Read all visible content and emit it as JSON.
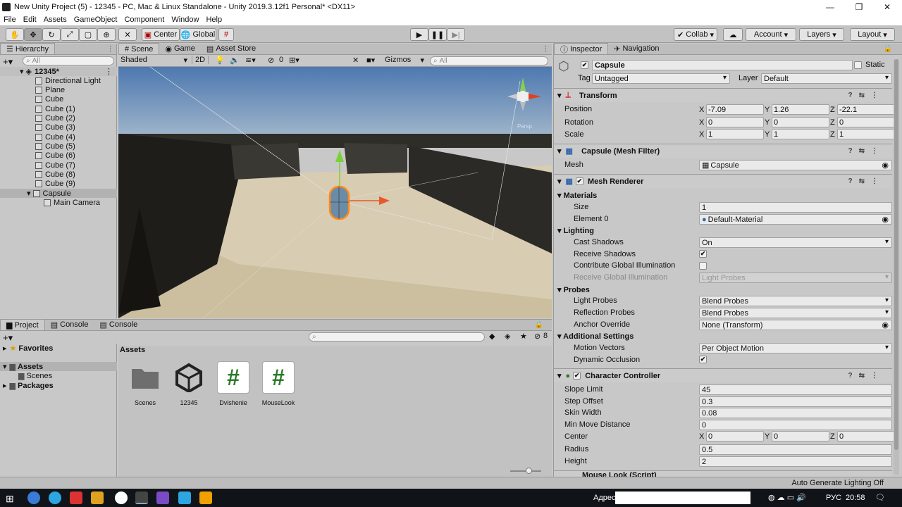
{
  "window": {
    "title": "New Unity Project (5) - 12345 - PC, Mac & Linux Standalone - Unity 2019.3.12f1 Personal* <DX11>"
  },
  "menu": [
    "File",
    "Edit",
    "Assets",
    "GameObject",
    "Component",
    "Window",
    "Help"
  ],
  "toolbar": {
    "center_label": "Center",
    "global_label": "Global",
    "collab_label": "Collab",
    "account_label": "Account",
    "layers_label": "Layers",
    "layout_label": "Layout"
  },
  "hierarchy": {
    "tab": "Hierarchy",
    "search_placeholder": "All",
    "scene_name": "12345*",
    "items": [
      "Directional Light",
      "Plane",
      "Cube",
      "Cube (1)",
      "Cube (2)",
      "Cube (3)",
      "Cube (4)",
      "Cube (5)",
      "Cube (6)",
      "Cube (7)",
      "Cube (8)",
      "Cube (9)",
      "Capsule",
      "Main Camera"
    ]
  },
  "scene": {
    "tabs": [
      "Scene",
      "Game",
      "Asset Store"
    ],
    "shading": "Shaded",
    "mode_2d": "2D",
    "hidden_count": "0",
    "gizmos": "Gizmos",
    "search_placeholder": "All",
    "persp": "Persp"
  },
  "inspector": {
    "tabs": [
      "Inspector",
      "Navigation"
    ],
    "object_name": "Capsule",
    "static_label": "Static",
    "tag_label": "Tag",
    "tag_value": "Untagged",
    "layer_label": "Layer",
    "layer_value": "Default",
    "transform": {
      "title": "Transform",
      "position_label": "Position",
      "rotation_label": "Rotation",
      "scale_label": "Scale",
      "position": [
        "-7.09",
        "1.26",
        "-22.1"
      ],
      "rotation": [
        "0",
        "0",
        "0"
      ],
      "scale": [
        "1",
        "1",
        "1"
      ]
    },
    "mesh_filter": {
      "title": "Capsule (Mesh Filter)",
      "mesh_label": "Mesh",
      "mesh_value": "Capsule"
    },
    "mesh_renderer": {
      "title": "Mesh Renderer",
      "materials": "Materials",
      "size_label": "Size",
      "size": "1",
      "element0_label": "Element 0",
      "element0": "Default-Material",
      "lighting": "Lighting",
      "cast_shadows_label": "Cast Shadows",
      "cast_shadows": "On",
      "receive_shadows_label": "Receive Shadows",
      "contribute_gi_label": "Contribute Global Illumination",
      "receive_gi_label": "Receive Global Illumination",
      "receive_gi": "Light Probes",
      "probes": "Probes",
      "light_probes_label": "Light Probes",
      "light_probes": "Blend Probes",
      "reflection_probes_label": "Reflection Probes",
      "reflection_probes": "Blend Probes",
      "anchor_label": "Anchor Override",
      "anchor": "None (Transform)",
      "additional": "Additional Settings",
      "motion_label": "Motion Vectors",
      "motion": "Per Object Motion",
      "dynamic_occlusion_label": "Dynamic Occlusion"
    },
    "character_controller": {
      "title": "Character Controller",
      "slope_label": "Slope Limit",
      "slope": "45",
      "step_label": "Step Offset",
      "step": "0.3",
      "skin_label": "Skin Width",
      "skin": "0.08",
      "min_move_label": "Min Move Distance",
      "min_move": "0",
      "center_label": "Center",
      "center": [
        "0",
        "0",
        "0"
      ],
      "radius_label": "Radius",
      "radius": "0.5",
      "height_label": "Height",
      "height": "2"
    },
    "next_component": "Mouse Look (Script)"
  },
  "project": {
    "tabs": [
      "Project",
      "Console",
      "Console"
    ],
    "favorites": "Favorites",
    "assets_root": "Assets",
    "scenes_folder": "Scenes",
    "packages": "Packages",
    "breadcrumb": "Assets",
    "layer_count": "8",
    "assets": [
      {
        "name": "Scenes",
        "icon": "folder-icon"
      },
      {
        "name": "12345",
        "icon": "unity-scene-icon"
      },
      {
        "name": "Dvishenie",
        "icon": "csharp-script-icon"
      },
      {
        "name": "MouseLook",
        "icon": "csharp-script-icon"
      }
    ]
  },
  "status": {
    "text": "Auto Generate Lighting Off"
  },
  "taskbar": {
    "address_label": "Адрес",
    "lang": "РУС",
    "time": "20:58"
  }
}
